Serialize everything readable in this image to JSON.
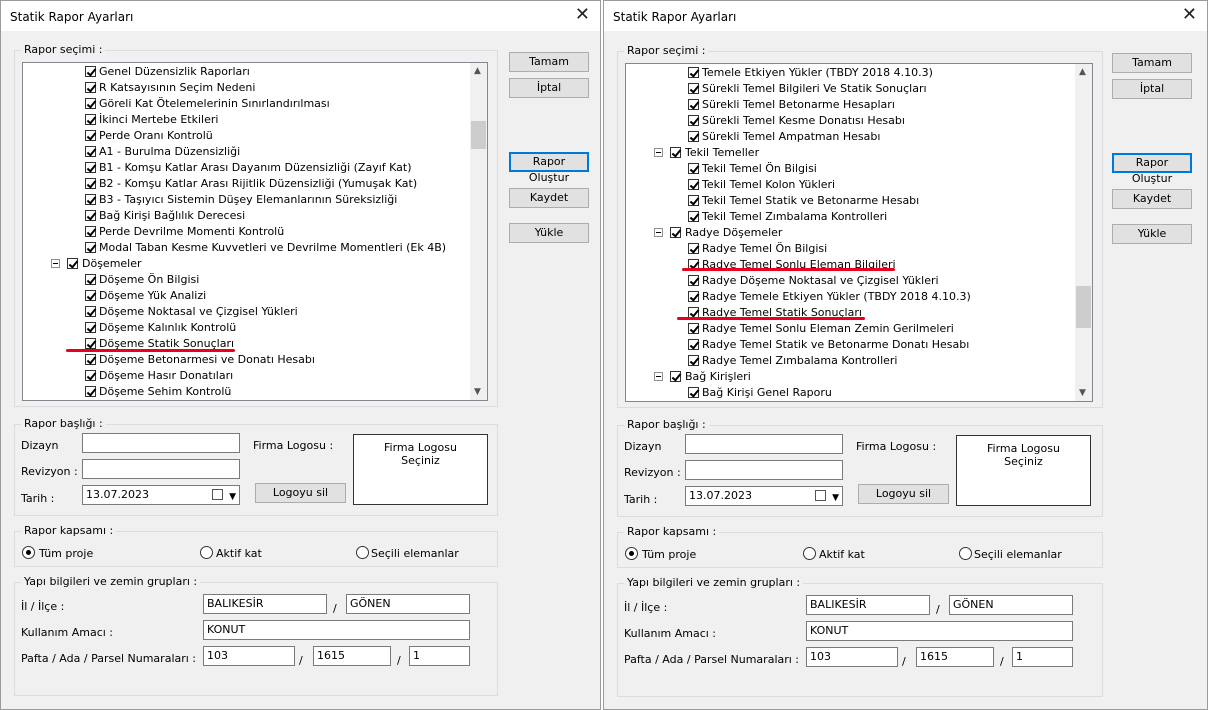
{
  "title": "Statik Rapor Ayarları",
  "buttons": {
    "ok": "Tamam",
    "cancel": "İptal",
    "create": "Rapor Oluştur",
    "save": "Kaydet",
    "load": "Yükle"
  },
  "rapor_secimi_label": "Rapor seçimi :",
  "left_tree": [
    {
      "level": 1,
      "label": "Genel Düzensizlik Raporları"
    },
    {
      "level": 1,
      "label": "R Katsayısının Seçim Nedeni"
    },
    {
      "level": 1,
      "label": "Göreli Kat Ötelemelerinin Sınırlandırılması"
    },
    {
      "level": 1,
      "label": "İkinci Mertebe Etkileri"
    },
    {
      "level": 1,
      "label": "Perde Oranı Kontrolü"
    },
    {
      "level": 1,
      "label": "A1 - Burulma Düzensizliği"
    },
    {
      "level": 1,
      "label": "B1 - Komşu Katlar Arası Dayanım Düzensizliği (Zayıf Kat)"
    },
    {
      "level": 1,
      "label": "B2 - Komşu Katlar Arası Rijitlik Düzensizliği (Yumuşak Kat)"
    },
    {
      "level": 1,
      "label": "B3 - Taşıyıcı Sistemin Düşey Elemanlarının Süreksizliği"
    },
    {
      "level": 1,
      "label": "Bağ Kirişi Bağlılık Derecesi"
    },
    {
      "level": 1,
      "label": "Perde Devrilme Momenti Kontrolü"
    },
    {
      "level": 1,
      "label": "Modal Taban Kesme Kuvvetleri ve Devrilme Momentleri  (Ek 4B)"
    },
    {
      "level": 0,
      "label": "Döşemeler"
    },
    {
      "level": 1,
      "label": "Döşeme Ön Bilgisi"
    },
    {
      "level": 1,
      "label": "Döşeme Yük Analizi"
    },
    {
      "level": 1,
      "label": "Döşeme Noktasal ve Çizgisel Yükleri"
    },
    {
      "level": 1,
      "label": "Döşeme Kalınlık Kontrolü"
    },
    {
      "level": 1,
      "label": "Döşeme Statik Sonuçları"
    },
    {
      "level": 1,
      "label": "Döşeme Betonarmesi ve Donatı Hesabı"
    },
    {
      "level": 1,
      "label": "Döşeme Hasır Donatıları"
    },
    {
      "level": 1,
      "label": "Döşeme Sehim Kontrolü"
    }
  ],
  "right_tree": [
    {
      "level": 1,
      "label": "Temele Etkiyen Yükler (TBDY 2018 4.10.3)"
    },
    {
      "level": 1,
      "label": "Sürekli Temel Bilgileri Ve Statik Sonuçları"
    },
    {
      "level": 1,
      "label": "Sürekli Temel Betonarme Hesapları"
    },
    {
      "level": 1,
      "label": "Sürekli Temel Kesme Donatısı Hesabı"
    },
    {
      "level": 1,
      "label": "Sürekli Temel Ampatman Hesabı"
    },
    {
      "level": 0,
      "label": "Tekil Temeller"
    },
    {
      "level": 1,
      "label": "Tekil Temel Ön Bilgisi"
    },
    {
      "level": 1,
      "label": "Tekil Temel Kolon Yükleri"
    },
    {
      "level": 1,
      "label": "Tekil Temel Statik ve Betonarme Hesabı"
    },
    {
      "level": 1,
      "label": "Tekil Temel Zımbalama Kontrolleri"
    },
    {
      "level": 0,
      "label": "Radye Döşemeler"
    },
    {
      "level": 1,
      "label": "Radye Temel Ön Bilgisi"
    },
    {
      "level": 1,
      "label": "Radye Temel Sonlu Eleman Bilgileri"
    },
    {
      "level": 1,
      "label": "Radye Döşeme Noktasal ve Çizgisel Yükleri"
    },
    {
      "level": 1,
      "label": "Radye Temele Etkiyen Yükler (TBDY 2018 4.10.3)"
    },
    {
      "level": 1,
      "label": "Radye Temel Statik Sonuçları"
    },
    {
      "level": 1,
      "label": "Radye Temel Sonlu Eleman Zemin Gerilmeleri"
    },
    {
      "level": 1,
      "label": "Radye Temel Statik ve Betonarme Donatı Hesabı"
    },
    {
      "level": 1,
      "label": "Radye Temel Zımbalama Kontrolleri"
    },
    {
      "level": 0,
      "label": "Bağ Kirişleri"
    },
    {
      "level": 1,
      "label": "Bağ Kirişi Genel Raporu"
    }
  ],
  "header": {
    "group_label": "Rapor başlığı :",
    "dizayn_label": "Dizayn",
    "revizyon_label": "Revizyon :",
    "tarih_label": "Tarih :",
    "dizayn_value": "",
    "revizyon_value": "",
    "tarih_value": "13.07.2023",
    "logo_label": "Firma Logosu :",
    "logo_box_line1": "Firma Logosu",
    "logo_box_line2": "Seçiniz",
    "logo_delete": "Logoyu sil"
  },
  "scope": {
    "group_label": "Rapor kapsamı :",
    "all": "Tüm proje",
    "active": "Aktif kat",
    "selected": "Seçili elemanlar",
    "selected_option": "Tüm proje"
  },
  "building": {
    "group_label": "Yapı bilgileri ve zemin grupları :",
    "il_label": "İl / İlçe :",
    "il_value": "BALIKESİR",
    "ilce_value": "GÖNEN",
    "amac_label": "Kullanım Amacı :",
    "amac_value": "KONUT",
    "pafta_label": "Pafta / Ada / Parsel Numaraları :",
    "pafta_value": "103",
    "ada_value": "1615",
    "parsel_value": "1",
    "slash": "/"
  },
  "colors": {
    "accent": "#0078d7",
    "annotation": "#e8001c",
    "dialog_bg": "#f0f0f0"
  }
}
